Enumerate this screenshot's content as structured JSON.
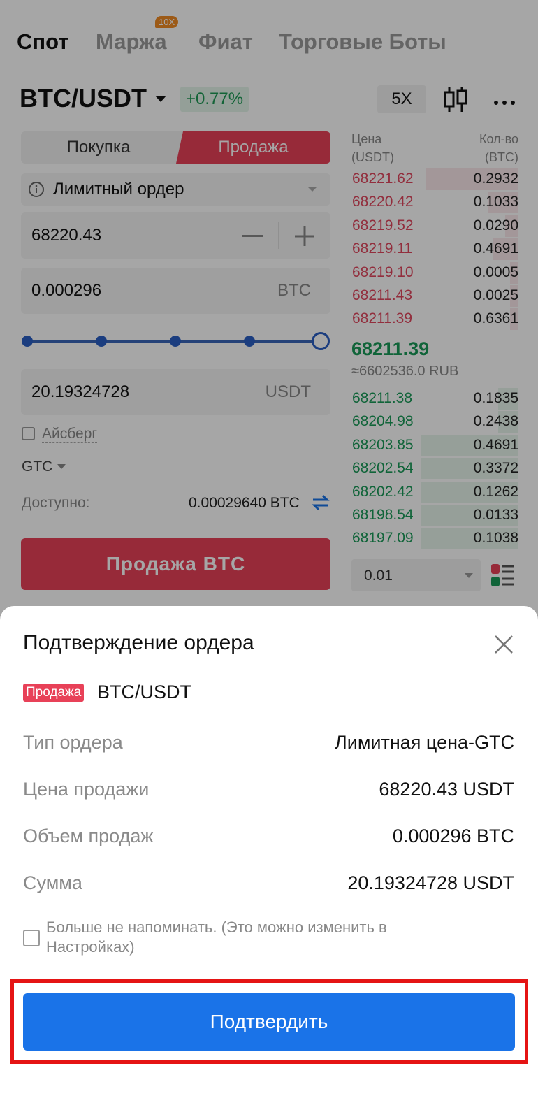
{
  "nav": {
    "tabs": [
      {
        "label": "Спот",
        "active": true
      },
      {
        "label": "Маржа",
        "active": false
      },
      {
        "label": "Фиат",
        "active": false
      },
      {
        "label": "Торговые Боты",
        "active": false
      }
    ],
    "margin_badge": "10X"
  },
  "ticker": {
    "pair": "BTC/USDT",
    "change": "+0.77%",
    "leverage": "5X"
  },
  "order_form": {
    "buy_label": "Покупка",
    "sell_label": "Продажа",
    "order_type": "Лимитный ордер",
    "price": "68220.43",
    "amount": "0.000296",
    "amount_unit": "BTC",
    "slider_level_percent": 100,
    "total": "20.19324728",
    "total_unit": "USDT",
    "iceberg_label": "Айсберг",
    "tif": "GTC",
    "available_label": "Доступно:",
    "available_value": "0.00029640 BTC",
    "submit_label": "Продажа  BTC"
  },
  "orderbook": {
    "price_header": [
      "Цена",
      "(USDT)"
    ],
    "qty_header": [
      "Кол-во",
      "(BTC)"
    ],
    "asks": [
      {
        "price": "68221.62",
        "qty": "0.2932",
        "depth": 0.55
      },
      {
        "price": "68220.42",
        "qty": "0.1033",
        "depth": 0.18
      },
      {
        "price": "68219.52",
        "qty": "0.0290",
        "depth": 0.08
      },
      {
        "price": "68219.11",
        "qty": "0.4691",
        "depth": 0.15
      },
      {
        "price": "68219.10",
        "qty": "0.0005",
        "depth": 0.05
      },
      {
        "price": "68211.43",
        "qty": "0.0025",
        "depth": 0.05
      },
      {
        "price": "68211.39",
        "qty": "0.6361",
        "depth": 0.05
      }
    ],
    "last_price": "68211.39",
    "last_price_rub": "≈6602536.0 RUB",
    "bids": [
      {
        "price": "68211.38",
        "qty": "0.1835",
        "depth": 0.12
      },
      {
        "price": "68204.98",
        "qty": "0.2438",
        "depth": 0.12
      },
      {
        "price": "68203.85",
        "qty": "0.4691",
        "depth": 0.58
      },
      {
        "price": "68202.54",
        "qty": "0.3372",
        "depth": 0.58
      },
      {
        "price": "68202.42",
        "qty": "0.1262",
        "depth": 0.58
      },
      {
        "price": "68198.54",
        "qty": "0.0133",
        "depth": 0.58
      },
      {
        "price": "68197.09",
        "qty": "0.1038",
        "depth": 0.58
      }
    ],
    "depth_value": "0.01"
  },
  "confirm_sheet": {
    "title": "Подтверждение ордера",
    "side_badge": "Продажа",
    "pair": "BTC/USDT",
    "rows": [
      {
        "label": "Тип ордера",
        "value": "Лимитная цена-GTC"
      },
      {
        "label": "Цена продажи",
        "value": "68220.43 USDT"
      },
      {
        "label": "Объем продаж",
        "value": "0.000296 BTC"
      },
      {
        "label": "Сумма",
        "value": "20.19324728 USDT"
      }
    ],
    "remind_text": "Больше не напоминать. (Это можно изменить в Настройках)",
    "confirm_label": "Подтвердить"
  },
  "colors": {
    "sell": "#e84158",
    "buy": "#1a9a58",
    "primary": "#1a73e8",
    "highlight": "#e51414"
  }
}
